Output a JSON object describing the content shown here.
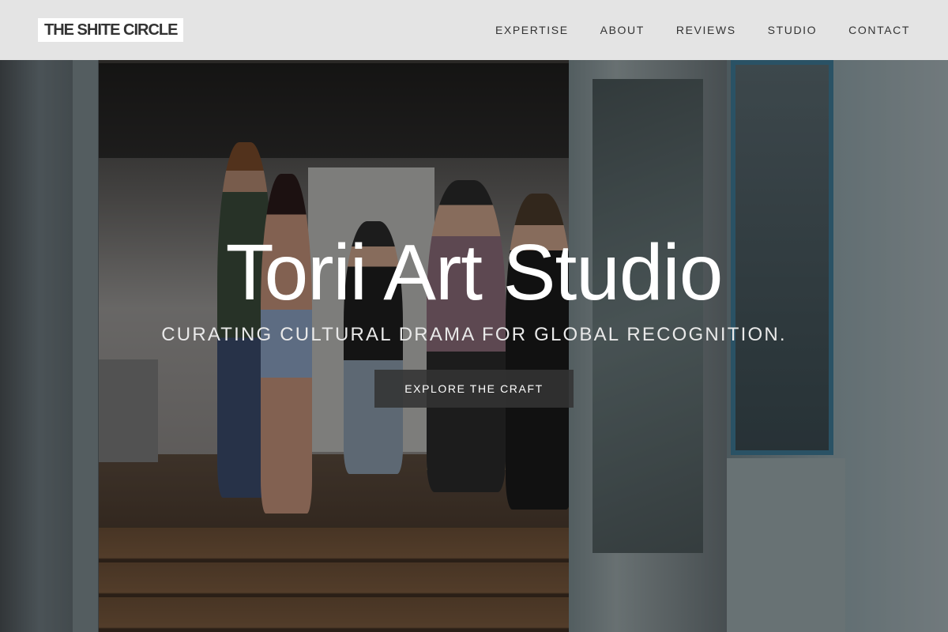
{
  "nav": {
    "brand": "THE SHITE CIRCLE",
    "links": [
      {
        "label": "EXPERTISE"
      },
      {
        "label": "ABOUT"
      },
      {
        "label": "REVIEWS"
      },
      {
        "label": "STUDIO"
      },
      {
        "label": "CONTACT"
      }
    ]
  },
  "hero": {
    "title": "Torii Art Studio",
    "subtitle": "CURATING CULTURAL DRAMA FOR GLOBAL RECOGNITION.",
    "cta_label": "EXPLORE THE CRAFT"
  },
  "colors": {
    "nav_background": "#ececec",
    "nav_text": "#333333",
    "button_background": "#333333",
    "hero_text": "#ffffff"
  }
}
